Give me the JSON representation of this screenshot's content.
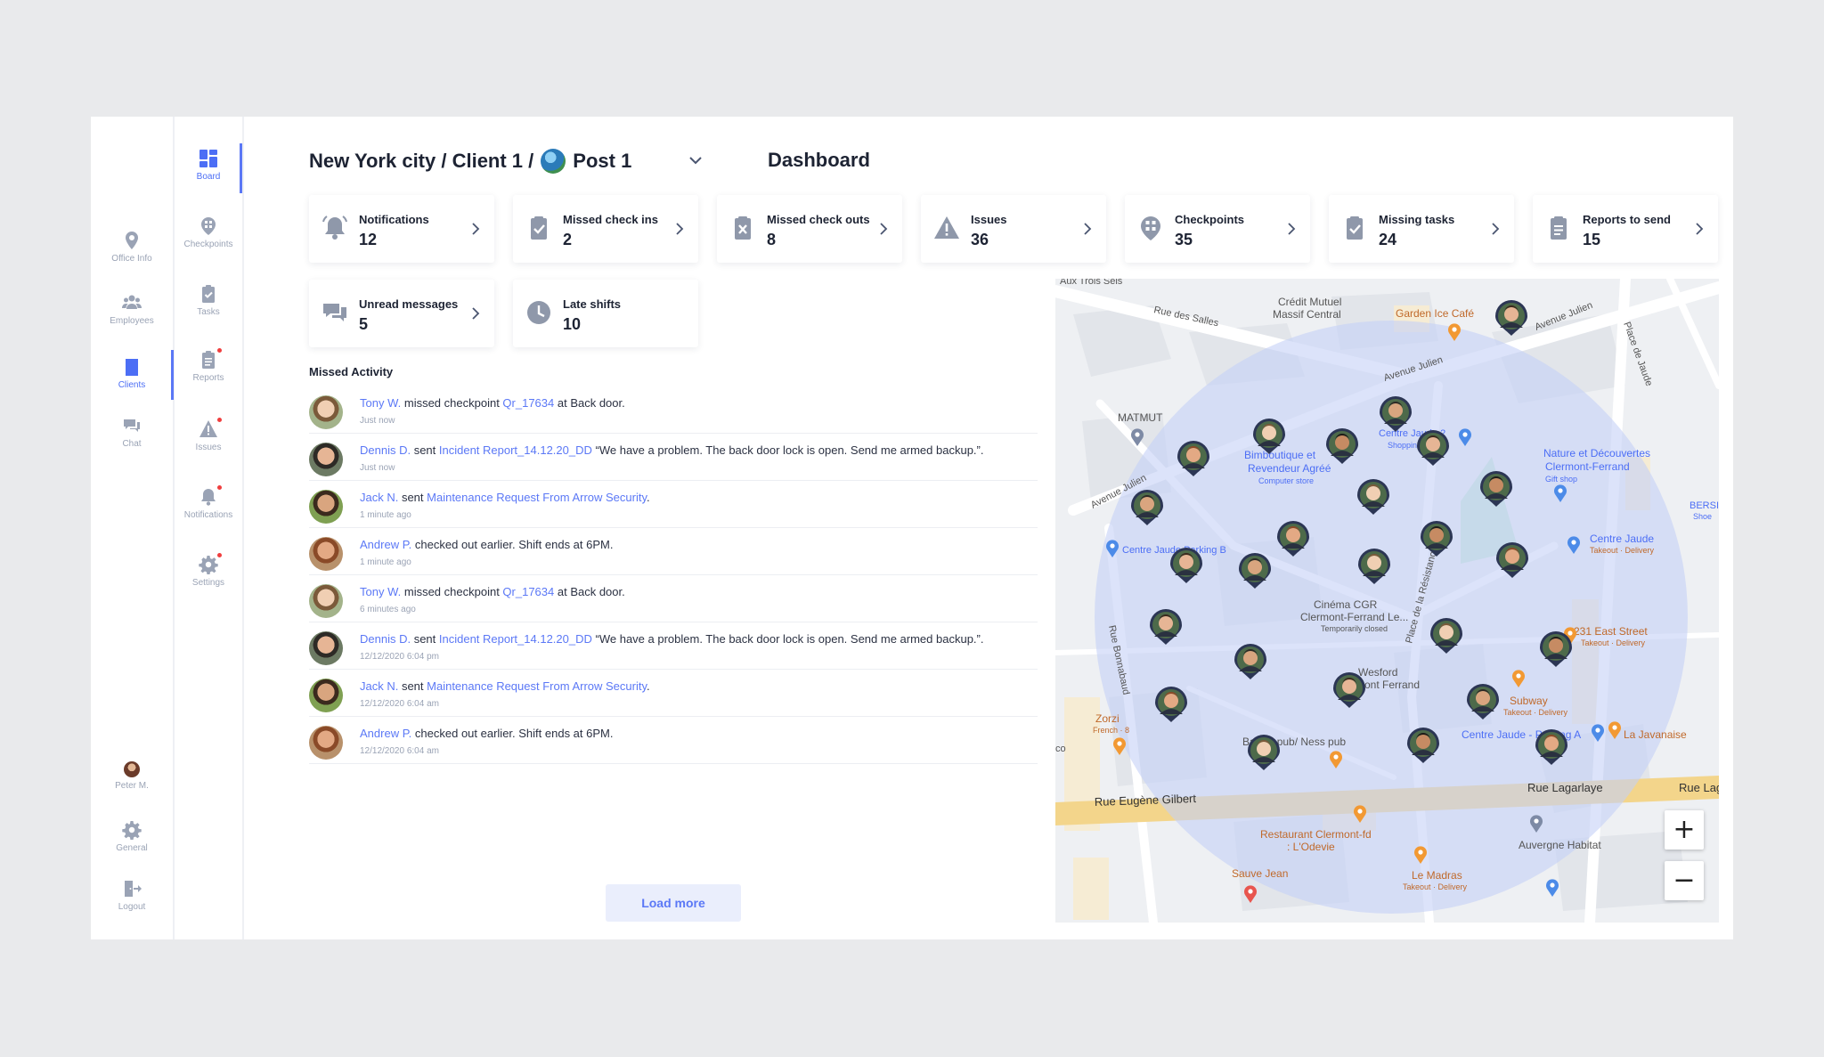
{
  "nav_primary": {
    "items": [
      {
        "label": "Office Info",
        "icon": "location-pin-icon"
      },
      {
        "label": "Employees",
        "icon": "people-icon"
      },
      {
        "label": "Clients",
        "icon": "building-icon"
      },
      {
        "label": "Chat",
        "icon": "chat-icon"
      }
    ],
    "user": {
      "label": "Peter M."
    },
    "general": {
      "label": "General"
    },
    "logout": {
      "label": "Logout"
    }
  },
  "nav_secondary": {
    "items": [
      {
        "label": "Board",
        "icon": "dashboard-icon"
      },
      {
        "label": "Checkpoints",
        "icon": "checkpoint-icon"
      },
      {
        "label": "Tasks",
        "icon": "clipboard-check-icon"
      },
      {
        "label": "Reports",
        "icon": "report-icon"
      },
      {
        "label": "Issues",
        "icon": "warning-icon"
      },
      {
        "label": "Notifications",
        "icon": "bell-icon"
      },
      {
        "label": "Settings",
        "icon": "gear-icon"
      }
    ]
  },
  "header": {
    "breadcrumb_prefix": "New York city / Client 1 /",
    "post": "Post 1",
    "title": "Dashboard"
  },
  "stats": [
    {
      "label": "Notifications",
      "value": "12",
      "icon": "bell-icon"
    },
    {
      "label": "Missed check ins",
      "value": "2",
      "icon": "clipboard-check-icon"
    },
    {
      "label": "Missed check outs",
      "value": "8",
      "icon": "clipboard-x-icon"
    },
    {
      "label": "Issues",
      "value": "36",
      "icon": "warning-icon"
    },
    {
      "label": "Checkpoints",
      "value": "35",
      "icon": "checkpoint-icon"
    },
    {
      "label": "Missing tasks",
      "value": "24",
      "icon": "clipboard-check-icon"
    },
    {
      "label": "Reports to send",
      "value": "15",
      "icon": "report-icon"
    },
    {
      "label": "Unread messages",
      "value": "5",
      "icon": "chat-icon"
    },
    {
      "label": "Late shifts",
      "value": "10",
      "icon": "clock-icon"
    }
  ],
  "activity": {
    "title": "Missed Activity",
    "items": [
      {
        "name": "Tony W.",
        "pre": " missed checkpoint ",
        "link": "Qr_17634",
        "post": " at Back door.",
        "time": "Just now"
      },
      {
        "name": "Dennis D.",
        "pre": " sent ",
        "link": "Incident Report_14.12.20_DD",
        "post": " “We have a problem. The back door lock is open. Send me armed backup.”.",
        "time": "Just now"
      },
      {
        "name": "Jack N.",
        "pre": " sent ",
        "link": "Maintenance Request From Arrow Security",
        "post": ".",
        "time": "1 minute ago"
      },
      {
        "name": "Andrew P.",
        "pre": " checked out earlier. Shift ends at 6PM.",
        "link": "",
        "post": "",
        "time": "1 minute ago"
      },
      {
        "name": "Tony W.",
        "pre": " missed checkpoint ",
        "link": "Qr_17634",
        "post": " at Back door.",
        "time": "6 minutes ago"
      },
      {
        "name": "Dennis D.",
        "pre": " sent ",
        "link": "Incident Report_14.12.20_DD",
        "post": " “We have a problem. The back door lock is open. Send me armed backup.”.",
        "time": "12/12/2020 6:04 pm"
      },
      {
        "name": "Jack N.",
        "pre": " sent ",
        "link": "Maintenance Request From Arrow Security",
        "post": ".",
        "time": "12/12/2020 6:04 am"
      },
      {
        "name": "Andrew P.",
        "pre": " checked out earlier. Shift ends at 6PM.",
        "link": "",
        "post": "",
        "time": "12/12/2020 6:04 am"
      }
    ],
    "load_more": "Load more"
  },
  "map": {
    "labels": {
      "aux_trois": "Aux Trois Sels",
      "rue_des_salles": "Rue des Salles",
      "credit_mutuel": "Crédit Mutuel",
      "massif_central": "Massif Central",
      "garden_ice": "Garden Ice Café",
      "avenue_julien_1": "Avenue Julien",
      "avenue_julien_2": "Avenue Julien",
      "avenue_julien_3": "Avenue Julien",
      "place_de_jaude": "Place de Jaude",
      "matmut": "MATMUT",
      "centre_jaude_2": "Centre Jaude 2",
      "centre_jaude_2_sub": "Shopping",
      "bimboutique": "Bimboutique et",
      "revendeur": "Revendeur Agréé",
      "computer_store": "Computer store",
      "nature": "Nature et Découvertes",
      "clermont_ferrand": "Clermont-Ferrand",
      "gift_shop": "Gift shop",
      "bers": "BERSI",
      "shoe": "Shoe",
      "centre_parking": "Centre Jaude Parking B",
      "centre_jaude": "Centre Jaude",
      "centre_jaude_sub": "Takeout · Delivery",
      "cinema": "Cinéma CGR",
      "cinema2": "Clermont-Ferrand Le...",
      "temp_closed": "Temporarily closed",
      "place_resistance": "Place de la Résistance",
      "rue_bonnabaud": "Rue Bonnabaud",
      "east_street": "231 East Street",
      "east_street_sub": "Takeout · Delivery",
      "wesford": "Wesford",
      "wesford2": "Clermont Ferrand",
      "subway": "Subway",
      "subway_sub": "Takeout · Delivery",
      "zorzi": "Zorzi",
      "zorzi_sub": "French · 8",
      "pub": "Bar du pub/ Ness pub",
      "centre_jaude_a": "Centre Jaude - Parking A",
      "la_javanaise": "La Javanaise",
      "rue_eugene": "Rue Eugène Gilbert",
      "rue_lagarlaye": "Rue Lagarlaye",
      "rue_lag2": "Rue Lag",
      "restaurant": "Restaurant Clermont-fd",
      "odevie": ": L'Odevie",
      "auvergne": "Auvergne Habitat",
      "le_madras": "Le Madras",
      "le_madras_sub": "Takeout · Delivery",
      "sauve_jean": "Sauve Jean",
      "co": "co"
    },
    "zoom_in": "+",
    "zoom_out": "−"
  },
  "colors": {
    "accent": "#5b78f6",
    "alert_dot": "#f03e3e",
    "map_circle": "#c8d3f7"
  }
}
